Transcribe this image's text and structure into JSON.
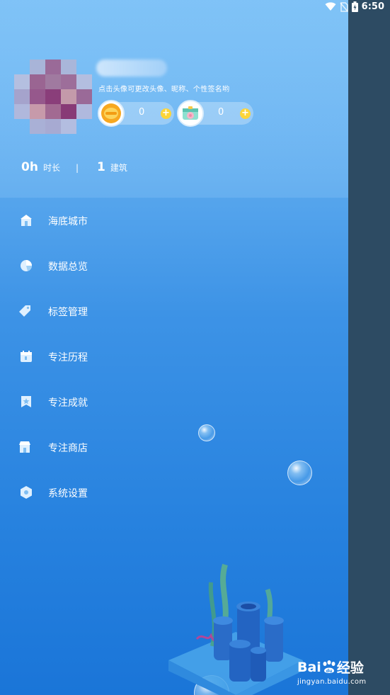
{
  "status_bar": {
    "time": "6:50",
    "icons": [
      "wifi-icon",
      "no-sim-icon",
      "battery-icon"
    ]
  },
  "profile": {
    "hint": "点击头像可更改头像、昵称、个性签名哟",
    "coins": {
      "value": "0",
      "plus": "+"
    },
    "shells": {
      "value": "0",
      "plus": "+"
    }
  },
  "stats": {
    "duration_value": "0h",
    "duration_label": "时长",
    "separator": "|",
    "buildings_value": "1",
    "buildings_label": "建筑"
  },
  "menu": {
    "items": [
      {
        "label": "海底城市",
        "icon": "building-icon"
      },
      {
        "label": "数据总览",
        "icon": "pie-chart-icon"
      },
      {
        "label": "标签管理",
        "icon": "tag-icon"
      },
      {
        "label": "专注历程",
        "icon": "calendar-icon"
      },
      {
        "label": "专注成就",
        "icon": "bookmark-star-icon"
      },
      {
        "label": "专注商店",
        "icon": "shop-icon"
      },
      {
        "label": "系统设置",
        "icon": "settings-hex-icon"
      }
    ]
  },
  "watermark": {
    "brand_left": "Bai",
    "brand_right": "经验",
    "url": "jingyan.baidu.com"
  },
  "colors": {
    "drawer_top": "#7cc1f6",
    "drawer_bottom": "#1a75d8",
    "side_pane": "#2d4b63",
    "plus_badge": "#fcd53a"
  }
}
